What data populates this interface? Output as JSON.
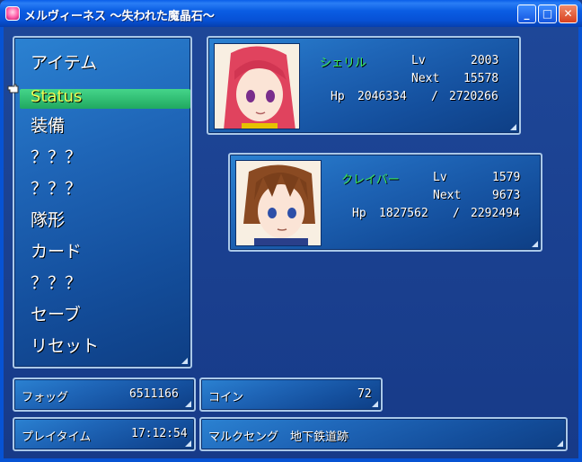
{
  "window": {
    "title": "メルヴィーネス ～失われた魔晶石～",
    "minimize": "_",
    "maximize": "□",
    "close": "✕"
  },
  "menu": {
    "items": [
      "アイテム",
      "Status",
      "装備",
      "？？？",
      "？？？",
      "隊形",
      "カード",
      "？？？",
      "セーブ",
      "リセット"
    ],
    "selected_index": 1
  },
  "party": [
    {
      "name": "シェリル",
      "lv_label": "Lv",
      "lv": "2003",
      "next_label": "Next",
      "next": "15578",
      "hp_label": "Hp",
      "hp": "2046334",
      "hp_sep": "/",
      "hp_max": "2720266",
      "hair": "#e0435e"
    },
    {
      "name": "クレイバー",
      "lv_label": "Lv",
      "lv": "1579",
      "next_label": "Next",
      "next": "9673",
      "hp_label": "Hp",
      "hp": "1827562",
      "hp_sep": "/",
      "hp_max": "2292494",
      "hair": "#8a4a22"
    }
  ],
  "status_bar": {
    "fog_label": "フォッグ",
    "fog_value": "6511166",
    "coin_label": "コイン",
    "coin_value": "72",
    "playtime_label": "プレイタイム",
    "playtime_value": "17:12:54",
    "location": "マルクセング　地下鉄道跡"
  }
}
